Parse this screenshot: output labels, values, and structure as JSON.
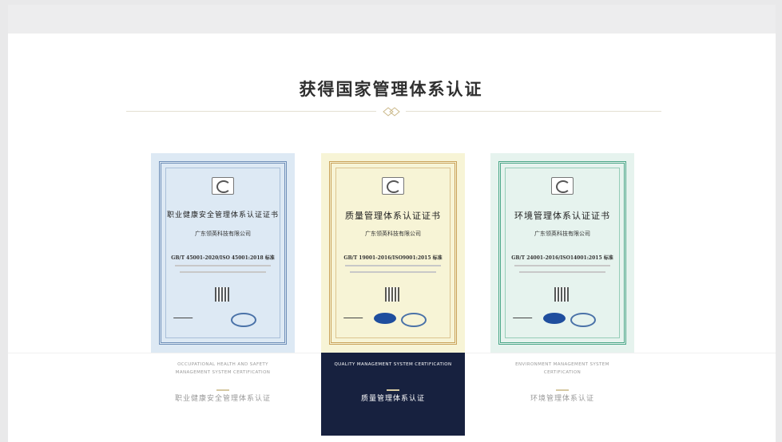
{
  "section": {
    "title": "获得国家管理体系认证"
  },
  "certificates": [
    {
      "cert_title": "职业健康安全管理体系认证证书",
      "company": "广东领英科技有限公司",
      "standard": "GB/T 45001-2020/ISO 45001:2018 标准",
      "en_label": "OCCUPATIONAL HEALTH AND SAFETY MANAGEMENT SYSTEM CERTIFICATION",
      "cn_label": "职业健康安全管理体系认证",
      "theme_color": "#6f8fb8",
      "bg_color": "#dde9f4",
      "active": false
    },
    {
      "cert_title": "质量管理体系认证证书",
      "company": "广东领英科技有限公司",
      "standard": "GB/T 19001-2016/ISO9001:2015 标准",
      "en_label": "QUALITY MANAGEMENT SYSTEM CERTIFICATION",
      "cn_label": "质量管理体系认证",
      "theme_color": "#c9a25a",
      "bg_color": "#f7f4d6",
      "active": true
    },
    {
      "cert_title": "环境管理体系认证证书",
      "company": "广东领英科技有限公司",
      "standard": "GB/T 24001-2016/ISO14001:2015 标准",
      "en_label": "ENVIRONMENT MANAGEMENT SYSTEM CERTIFICATION",
      "cn_label": "环境管理体系认证",
      "theme_color": "#4aa687",
      "bg_color": "#e6f3ee",
      "active": false
    }
  ],
  "colors": {
    "active_bg": "#17213f",
    "accent_gold": "#d6c9a2"
  }
}
